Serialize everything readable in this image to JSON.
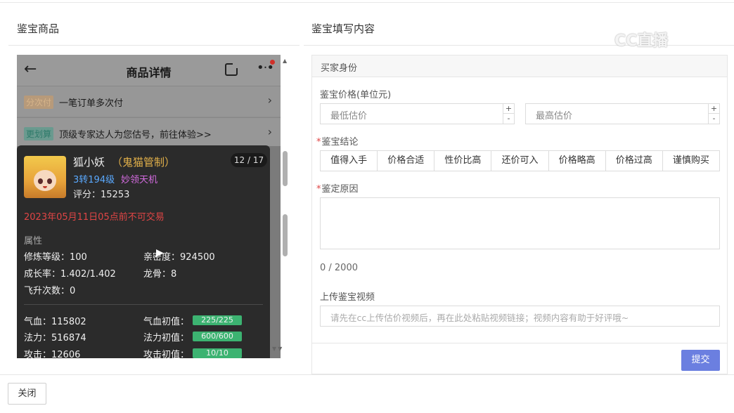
{
  "left_section_title": "鉴宝商品",
  "right_section_title": "鉴宝填写内容",
  "watermark": "CC直播",
  "phone": {
    "title": "商品详情",
    "rows": [
      {
        "tag": "分次付",
        "text": "一笔订单多次付"
      },
      {
        "tag": "更划算",
        "text": "顶级专家达人为您估号，前往体验>>"
      }
    ]
  },
  "pet_card": {
    "name": "狐小妖",
    "guild": "（鬼猫管制）",
    "level": "3转194级",
    "skill": "妙领天机",
    "score": "评分：15253",
    "pager": "12 / 17",
    "trade_warning": "2023年05月11日05点前不可交易",
    "attr_label": "属性",
    "attrs": [
      "修炼等级：100",
      "亲密度：924500",
      "成长率：1.402/1.402",
      "龙骨：8",
      "飞升次数：0"
    ],
    "stats": [
      {
        "label": "气血：115802",
        "init_label": "气血初值：",
        "init_value": "225/225"
      },
      {
        "label": "法力：516874",
        "init_label": "法力初值：",
        "init_value": "600/600"
      },
      {
        "label": "攻击：12606",
        "init_label": "攻击初值：",
        "init_value": "10/10"
      }
    ]
  },
  "form": {
    "header": "买家身份",
    "price_label": "鉴宝价格(单位元)",
    "min_placeholder": "最低估价",
    "max_placeholder": "最高估价",
    "stepper_plus": "+",
    "stepper_minus": "-",
    "conclusion_label": "鉴宝结论",
    "conclusion_options": [
      "值得入手",
      "价格合适",
      "性价比高",
      "还价可入",
      "价格略高",
      "价格过高",
      "谨慎购买"
    ],
    "reason_label": "鉴定原因",
    "counter": "0 / 2000",
    "video_label": "上传鉴宝视频",
    "video_placeholder": "请先在cc上传估价视频后，再在此处粘贴视频链接；视频内容有助于好评哦~",
    "submit": "提交"
  },
  "close_button": "关闭",
  "colors": {
    "accent": "#6b7fe0",
    "required": "#e04545",
    "warning": "#e04545",
    "init_bar": "#3cb371",
    "guild": "#e2b04a",
    "level": "#5aa9ff",
    "skill": "#d46be0"
  }
}
